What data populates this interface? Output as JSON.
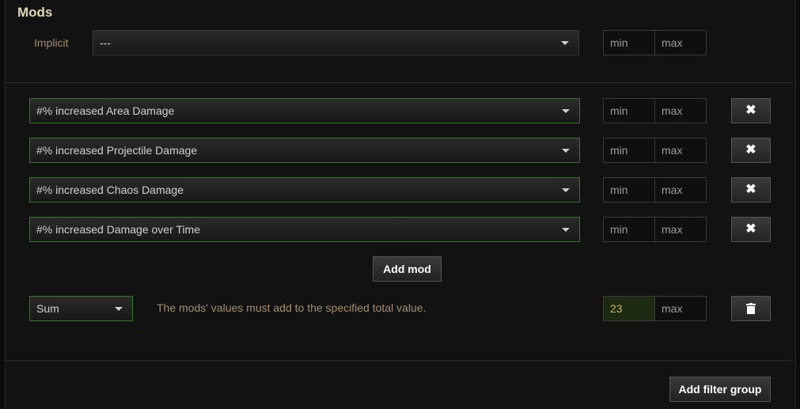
{
  "mods": {
    "title": "Mods",
    "implicit": {
      "label": "Implicit",
      "value": "---",
      "min_placeholder": "min",
      "max_placeholder": "max"
    },
    "rows": [
      {
        "value": "#% increased Area Damage",
        "min_placeholder": "min",
        "max_placeholder": "max",
        "remove_icon": "✖"
      },
      {
        "value": "#% increased Projectile Damage",
        "min_placeholder": "min",
        "max_placeholder": "max",
        "remove_icon": "✖"
      },
      {
        "value": "#% increased Chaos Damage",
        "min_placeholder": "min",
        "max_placeholder": "max",
        "remove_icon": "✖"
      },
      {
        "value": "#% increased Damage over Time",
        "min_placeholder": "min",
        "max_placeholder": "max",
        "remove_icon": "✖"
      }
    ],
    "add_mod_label": "Add mod",
    "group": {
      "type_value": "Sum",
      "description": "The mods' values must add to the specified total value.",
      "min_value": "23",
      "max_placeholder": "max"
    },
    "add_filter_group_label": "Add filter group"
  },
  "colors": {
    "accent_green": "#2f7a22",
    "label_tan": "#a38d6d",
    "title": "#e0d9b6"
  },
  "icons": {
    "remove": "close-icon",
    "delete": "trash-icon",
    "dropdown": "chevron-down-icon"
  }
}
